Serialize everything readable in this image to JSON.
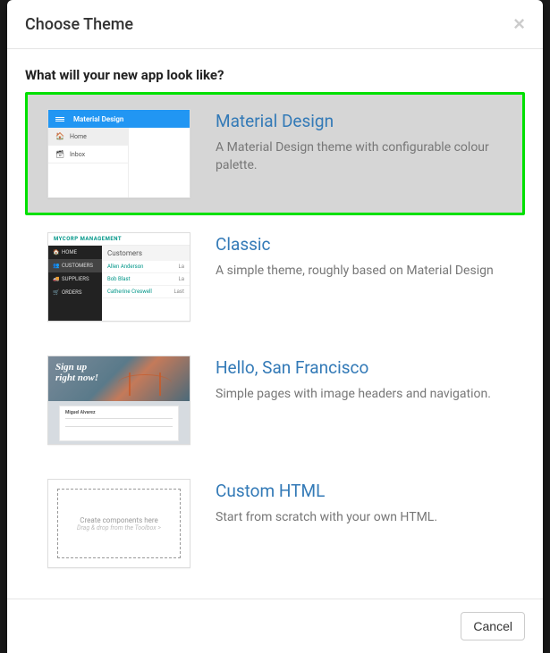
{
  "modal": {
    "title": "Choose Theme",
    "close_glyph": "×",
    "prompt": "What will your new app look like?",
    "cancel_label": "Cancel"
  },
  "themes": [
    {
      "name": "Material Design",
      "description": "A Material Design theme with configurable colour palette.",
      "selected": true,
      "thumb": {
        "topbar_label": "Material Design",
        "sidebar_items": [
          {
            "icon": "🏠",
            "label": "Home"
          },
          {
            "icon": "🗃",
            "label": "Inbox"
          }
        ]
      }
    },
    {
      "name": "Classic",
      "description": "A simple theme, roughly based on Material Design",
      "selected": false,
      "thumb": {
        "brand": "MYCORP MANAGEMENT",
        "sidebar_items": [
          {
            "icon": "🏠",
            "label": "HOME"
          },
          {
            "icon": "👥",
            "label": "CUSTOMERS"
          },
          {
            "icon": "🚚",
            "label": "SUPPLIERS"
          },
          {
            "icon": "🛒",
            "label": "ORDERS"
          }
        ],
        "main_heading": "Customers",
        "rows": [
          {
            "name": "Allen Anderson",
            "last": "La"
          },
          {
            "name": "Bob Blast",
            "last": "La"
          },
          {
            "name": "Catherine Creswell",
            "last": "Last"
          }
        ]
      }
    },
    {
      "name": "Hello, San Francisco",
      "description": "Simple pages with image headers and navigation.",
      "selected": false,
      "thumb": {
        "hero_line1": "Sign up",
        "hero_line2": "right now!",
        "form_label": "Miguel Alvarez"
      }
    },
    {
      "name": "Custom HTML",
      "description": "Start from scratch with your own HTML.",
      "selected": false,
      "thumb": {
        "line1": "Create components here",
        "line2": "Drag & drop from the Toolbox >"
      }
    }
  ]
}
